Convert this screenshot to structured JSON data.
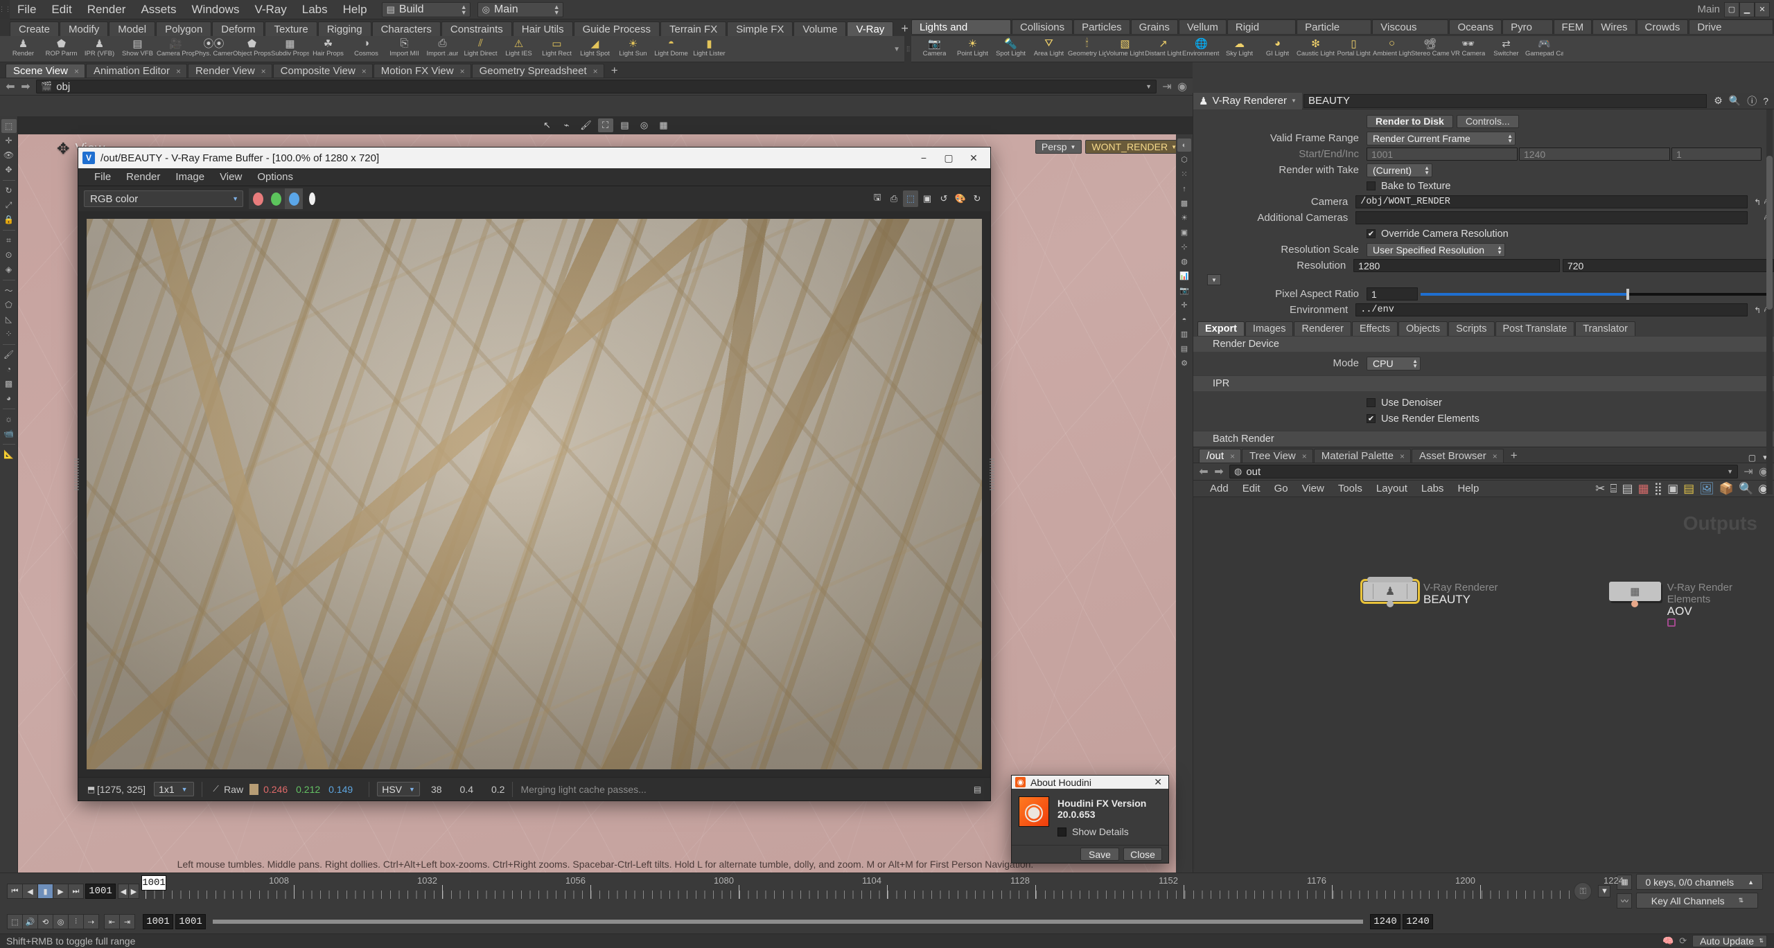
{
  "app": {
    "title": "Houdini FX",
    "menus": [
      "File",
      "Edit",
      "Render",
      "Assets",
      "Windows",
      "V-Ray",
      "Labs",
      "Help"
    ],
    "build_selector": "Build",
    "desktop_selector": "Main",
    "main_label": "Main"
  },
  "shelf": {
    "tabs": [
      "Create",
      "Modify",
      "Model",
      "Polygon",
      "Deform",
      "Texture",
      "Rigging",
      "Characters",
      "Constraints",
      "Hair Utils",
      "Guide Process",
      "Terrain FX",
      "Simple FX",
      "Volume",
      "V-Ray"
    ],
    "active_tab": "V-Ray",
    "add_label": "+",
    "tools": [
      {
        "label": "Render",
        "icon": "vray-render-icon",
        "glyph": "♟"
      },
      {
        "label": "ROP Parm",
        "icon": "rop-parm-icon",
        "glyph": "⬟"
      },
      {
        "label": "IPR (VFB)",
        "icon": "ipr-vfb-icon",
        "glyph": "▶"
      },
      {
        "label": "Show VFB",
        "icon": "show-vfb-icon",
        "glyph": "⬛"
      },
      {
        "label": "Camera Props",
        "icon": "camera-props-icon",
        "glyph": "Ἲ5"
      },
      {
        "label": "Phys. Camera",
        "icon": "physical-camera-icon",
        "glyph": "◎"
      },
      {
        "label": "Object Props",
        "icon": "object-props-icon",
        "glyph": "⬟"
      },
      {
        "label": "Subdiv Props",
        "icon": "subdiv-props-icon",
        "glyph": "▦"
      },
      {
        "label": "Hair Props",
        "icon": "hair-props-icon",
        "glyph": "☘"
      },
      {
        "label": "Cosmos",
        "icon": "cosmos-icon",
        "glyph": "◑"
      },
      {
        "label": "Import MII",
        "icon": "import-mtl-icon",
        "glyph": "⎘"
      },
      {
        "label": "Import .aur",
        "icon": "import-aur-icon",
        "glyph": "⎙"
      },
      {
        "label": "Light Direct",
        "icon": "light-direct-icon",
        "glyph": "╱"
      },
      {
        "label": "Light IES",
        "icon": "light-ies-icon",
        "glyph": "⚠"
      },
      {
        "label": "Light Rect",
        "icon": "light-rect-icon",
        "glyph": "▭"
      },
      {
        "label": "Light Spot",
        "icon": "light-spot-icon",
        "glyph": "◢"
      },
      {
        "label": "Light Sun",
        "icon": "light-sun-icon",
        "glyph": "☀"
      },
      {
        "label": "Light Dome",
        "icon": "light-dome-icon",
        "glyph": "◓"
      },
      {
        "label": "Light Lister",
        "icon": "light-lister-icon",
        "glyph": "Ὂ1"
      }
    ],
    "category_tabs": [
      "Lights and Cameras",
      "Collisions",
      "Particles",
      "Grains",
      "Vellum",
      "Rigid Bodies",
      "Particle Fluids",
      "Viscous Fluids",
      "Oceans",
      "Pyro FX",
      "FEM",
      "Wires",
      "Crowds",
      "Drive Simulation"
    ],
    "category_active": "Lights and Cameras",
    "right_tools": [
      {
        "label": "Camera",
        "icon": "camera-icon",
        "glyph": "὏7"
      },
      {
        "label": "Point Light",
        "icon": "point-light-icon",
        "glyph": "☀"
      },
      {
        "label": "Spot Light",
        "icon": "spot-light-icon",
        "glyph": "ὒ6"
      },
      {
        "label": "Area Light",
        "icon": "area-light-icon",
        "glyph": "⛛"
      },
      {
        "label": "Geometry Light",
        "icon": "geometry-light-icon",
        "glyph": "ὖF"
      },
      {
        "label": "Volume Light",
        "icon": "volume-light-icon",
        "glyph": "▧"
      },
      {
        "label": "Distant Light",
        "icon": "distant-light-icon",
        "glyph": "↗"
      },
      {
        "label": "Environment Light",
        "icon": "environment-light-icon",
        "glyph": "ἰD"
      },
      {
        "label": "Sky Light",
        "icon": "sky-light-icon",
        "glyph": "☁"
      },
      {
        "label": "GI Light",
        "icon": "gi-light-icon",
        "glyph": "◕"
      },
      {
        "label": "Caustic Light",
        "icon": "caustic-light-icon",
        "glyph": "❇"
      },
      {
        "label": "Portal Light",
        "icon": "portal-light-icon",
        "glyph": "▯"
      },
      {
        "label": "Ambient Light",
        "icon": "ambient-light-icon",
        "glyph": "○"
      },
      {
        "label": "Stereo Camera",
        "icon": "stereo-camera-icon",
        "glyph": "὏D"
      },
      {
        "label": "VR Camera",
        "icon": "vr-camera-icon",
        "glyph": "ὗ6"
      },
      {
        "label": "Switcher",
        "icon": "switcher-icon",
        "glyph": "⇄"
      },
      {
        "label": "Gamepad Camera",
        "icon": "gamepad-camera-icon",
        "glyph": "ἺE"
      }
    ]
  },
  "left_pane": {
    "tabs": [
      {
        "label": "Scene View",
        "closable": true
      },
      {
        "label": "Animation Editor",
        "closable": true
      },
      {
        "label": "Render View",
        "closable": true
      },
      {
        "label": "Composite View",
        "closable": true
      },
      {
        "label": "Motion FX View",
        "closable": true
      },
      {
        "label": "Geometry Spreadsheet",
        "closable": true
      }
    ],
    "active_tab": "Scene View",
    "add_label": "+",
    "path": "obj",
    "path_icon": "network-icon"
  },
  "viewport": {
    "label": "View",
    "camera_pill": "Persp",
    "render_pill": "WONT_RENDER",
    "hint": "Left mouse tumbles. Middle pans. Right dollies. Ctrl+Alt+Left box-zooms. Ctrl+Right zooms. Spacebar-Ctrl-Left tilts. Hold L for alternate tumble, dolly, and zoom. M or Alt+M for First Person Navigation."
  },
  "vfb": {
    "title": "/out/BEAUTY - V-Ray Frame Buffer - [100.0% of 1280 x 720]",
    "app_icon": "vray-logo-icon",
    "window_buttons": [
      "minimize",
      "maximize",
      "close"
    ],
    "menus": [
      "File",
      "Render",
      "Image",
      "View",
      "Options"
    ],
    "channel_select": "RGB color",
    "channels": [
      {
        "name": "red-channel",
        "color": "#e87c7c",
        "active": false
      },
      {
        "name": "green-channel",
        "color": "#5cc45c",
        "active": false
      },
      {
        "name": "blue-channel",
        "color": "#5ba6e8",
        "active": true
      }
    ],
    "alpha_icon": "alpha-channel-icon",
    "toolbar_icons": [
      "save-image-icon",
      "save-channels-icon",
      "region-render-icon",
      "show-in-viewer-icon",
      "undo-icon",
      "color-corrections-icon",
      "redo-icon"
    ],
    "status": {
      "pixel_icon": "color-picker-icon",
      "coords": "[1275, 325]",
      "zoom": "1x1",
      "curve_icon": "curve-icon",
      "mode": "Raw",
      "swatch": "#b79d75",
      "r": "0.246",
      "g": "0.212",
      "b": "0.149",
      "colorspace": "HSV",
      "h": "38",
      "s": "0.4",
      "v": "0.2",
      "message": "Merging light cache passes...",
      "layers_icon": "layers-icon"
    }
  },
  "right_panel": {
    "header": {
      "node_type": "V-Ray Renderer",
      "node_icon": "vray-renderer-icon",
      "node_name": "BEAUTY",
      "icons": [
        "gear-icon",
        "search-icon",
        "info-icon",
        "help-icon"
      ]
    },
    "buttons": {
      "render_to_disk": "Render to Disk",
      "controls": "Controls..."
    },
    "params": [
      {
        "label": "Valid Frame Range",
        "type": "menu",
        "value": "Render Current Frame"
      },
      {
        "label": "Start/End/Inc",
        "type": "triple",
        "values": [
          "1001",
          "1240",
          "1"
        ],
        "disabled": true
      },
      {
        "label": "Render with Take",
        "type": "menu",
        "value": "(Current)"
      },
      {
        "label": "",
        "type": "check",
        "text": "Bake to Texture",
        "checked": false
      },
      {
        "label": "Camera",
        "type": "field",
        "value": "/obj/WONT_RENDER"
      },
      {
        "label": "Additional Cameras",
        "type": "field",
        "value": ""
      },
      {
        "label": "",
        "type": "check",
        "text": "Override Camera Resolution",
        "checked": true
      },
      {
        "label": "Resolution Scale",
        "type": "menu",
        "value": "User Specified Resolution"
      },
      {
        "label": "Resolution",
        "type": "double",
        "values": [
          "1280",
          "720"
        ]
      },
      {
        "label": "Pixel Aspect Ratio",
        "type": "slider",
        "value": "1"
      },
      {
        "label": "Environment",
        "type": "field",
        "value": "../env"
      }
    ],
    "tabs": [
      "Export",
      "Images",
      "Renderer",
      "Effects",
      "Objects",
      "Scripts",
      "Post Translate",
      "Translator"
    ],
    "active_tab": "Renderer",
    "sections": [
      {
        "title": "Render Device",
        "rows": [
          {
            "label": "Mode",
            "type": "menu",
            "value": "CPU"
          }
        ]
      },
      {
        "title": "IPR",
        "rows": [
          {
            "label": "",
            "type": "check",
            "text": "Use Denoiser",
            "checked": false
          },
          {
            "label": "",
            "type": "check",
            "text": "Use Render Elements",
            "checked": true
          }
        ]
      },
      {
        "title": "Batch Render",
        "rows": []
      }
    ]
  },
  "network_editor": {
    "tabs": [
      {
        "label": "/out",
        "closable": true
      },
      {
        "label": "Tree View",
        "closable": true
      },
      {
        "label": "Material Palette",
        "closable": true
      },
      {
        "label": "Asset Browser",
        "closable": true
      }
    ],
    "active_tab": "/out",
    "add_label": "+",
    "path": "out",
    "path_icon": "out-network-icon",
    "menus": [
      "Add",
      "Edit",
      "Go",
      "View",
      "Tools",
      "Layout",
      "Labs",
      "Help"
    ],
    "toolbar_icons": [
      "tools-icon",
      "hierarchy-icon",
      "list-icon",
      "color-palette-icon",
      "grid-icon",
      "network-box-icon",
      "sticky-note-icon",
      "image-icon",
      "package-icon",
      "search-icon",
      "snapshot-icon"
    ],
    "watermark": "Outputs",
    "nodes": [
      {
        "type": "V-Ray Renderer",
        "name": "BEAUTY",
        "selected": true,
        "icon": "vray-renderer-node-icon",
        "output_color": "#b5b5b5"
      },
      {
        "type": "V-Ray Render Elements",
        "name": "AOV",
        "selected": false,
        "icon": "render-elements-node-icon",
        "output_color": "#e8a889"
      }
    ]
  },
  "about_dialog": {
    "title": "About Houdini",
    "icon": "houdini-logo-icon",
    "close_label": "✕",
    "version": "Houdini FX Version 20.0.653",
    "show_details_label": "Show Details",
    "show_details_checked": false,
    "buttons": {
      "save": "Save",
      "close": "Close"
    }
  },
  "timeline": {
    "current_frame": "1001",
    "frame_field": "1001",
    "range_start": "1001",
    "range_start2": "1001",
    "range_end": "1240",
    "range_end2": "1240",
    "tick_labels": [
      "1008",
      "1032",
      "1056",
      "1080",
      "1104",
      "1128",
      "1152",
      "1176",
      "1200",
      "1224"
    ],
    "keys_status": "0 keys, 0/0 channels",
    "key_mode": "Key All Channels",
    "auto_update": "Auto Update",
    "status_hint": "Shift+RMB to toggle full range",
    "transport": [
      "jump-to-start-icon",
      "step-back-icon",
      "play-icon",
      "step-forward-icon",
      "jump-to-end-icon"
    ]
  }
}
